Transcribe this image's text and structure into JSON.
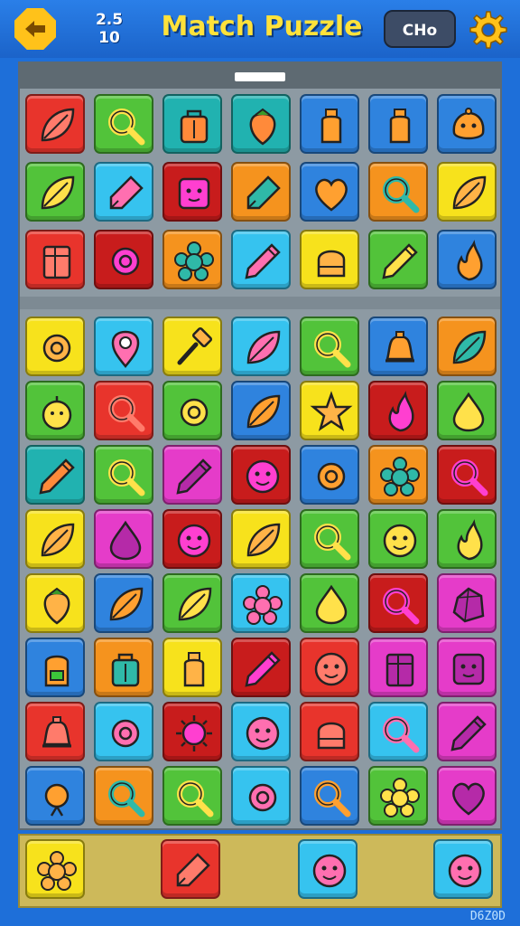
{
  "header": {
    "title": "Match Puzzle",
    "score_line1": "2.5",
    "score_line2": "10",
    "mode_button": "CHo",
    "back_icon": "back-arrow-icon",
    "settings_icon": "gear-icon"
  },
  "colors": {
    "red": "#e8342c",
    "yellow": "#f7e21c",
    "green": "#52c33a",
    "teal": "#21b2b0",
    "blue": "#2f83de",
    "orange": "#f5931e",
    "pink": "#e53cc9",
    "sky": "#36c3ef",
    "darkred": "#c81c1c"
  },
  "grid": [
    [
      {
        "color": "red",
        "icon": "leaf-icon"
      },
      {
        "color": "green",
        "icon": "magnifier-icon"
      },
      {
        "color": "teal",
        "icon": "bag-icon"
      },
      {
        "color": "teal",
        "icon": "strawberry-icon"
      },
      {
        "color": "blue",
        "icon": "bottle-icon"
      },
      {
        "color": "blue",
        "icon": "bottle-icon"
      },
      {
        "color": "blue",
        "icon": "blob-icon"
      }
    ],
    [
      {
        "color": "green",
        "icon": "leaf-icon"
      },
      {
        "color": "sky",
        "icon": "brush-icon"
      },
      {
        "color": "darkred",
        "icon": "cube-face-icon"
      },
      {
        "color": "orange",
        "icon": "brush-icon"
      },
      {
        "color": "blue",
        "icon": "heart-icon"
      },
      {
        "color": "orange",
        "icon": "magnifier-icon"
      },
      {
        "color": "yellow",
        "icon": "leaf-icon"
      }
    ],
    [
      {
        "color": "red",
        "icon": "box-icon"
      },
      {
        "color": "darkred",
        "icon": "ring-icon"
      },
      {
        "color": "orange",
        "icon": "flower-icon"
      },
      {
        "color": "sky",
        "icon": "pencil-icon"
      },
      {
        "color": "yellow",
        "icon": "jelly-icon"
      },
      {
        "color": "green",
        "icon": "pencil-icon"
      },
      {
        "color": "blue",
        "icon": "flame-icon"
      }
    ],
    [
      {
        "color": "yellow",
        "icon": "ring-icon"
      },
      {
        "color": "sky",
        "icon": "pin-icon"
      },
      {
        "color": "yellow",
        "icon": "hammer-icon"
      },
      {
        "color": "sky",
        "icon": "leaf-icon"
      },
      {
        "color": "green",
        "icon": "magnifier-icon"
      },
      {
        "color": "blue",
        "icon": "bell-icon"
      },
      {
        "color": "orange",
        "icon": "leaf-icon"
      }
    ],
    [
      {
        "color": "green",
        "icon": "fruit-icon"
      },
      {
        "color": "red",
        "icon": "magnifier-icon"
      },
      {
        "color": "green",
        "icon": "ring-icon"
      },
      {
        "color": "blue",
        "icon": "leaf-icon"
      },
      {
        "color": "yellow",
        "icon": "star-icon"
      },
      {
        "color": "darkred",
        "icon": "flame-icon"
      },
      {
        "color": "green",
        "icon": "drop-icon"
      }
    ],
    [
      {
        "color": "teal",
        "icon": "pencil-icon"
      },
      {
        "color": "green",
        "icon": "magnifier-icon"
      },
      {
        "color": "pink",
        "icon": "pencil-icon"
      },
      {
        "color": "darkred",
        "icon": "face-icon"
      },
      {
        "color": "blue",
        "icon": "ring-icon"
      },
      {
        "color": "orange",
        "icon": "flower-icon"
      },
      {
        "color": "darkred",
        "icon": "magnifier-icon"
      }
    ],
    [
      {
        "color": "yellow",
        "icon": "leaf-icon"
      },
      {
        "color": "pink",
        "icon": "drop-icon"
      },
      {
        "color": "darkred",
        "icon": "face-icon"
      },
      {
        "color": "yellow",
        "icon": "leaf-icon"
      },
      {
        "color": "green",
        "icon": "magnifier-icon"
      },
      {
        "color": "green",
        "icon": "face-icon"
      },
      {
        "color": "green",
        "icon": "flame-icon"
      }
    ],
    [
      {
        "color": "yellow",
        "icon": "strawberry-icon"
      },
      {
        "color": "blue",
        "icon": "leaf-icon"
      },
      {
        "color": "green",
        "icon": "leaf-icon"
      },
      {
        "color": "sky",
        "icon": "flower-icon"
      },
      {
        "color": "green",
        "icon": "drop-icon"
      },
      {
        "color": "darkred",
        "icon": "magnifier-icon"
      },
      {
        "color": "pink",
        "icon": "gem-icon"
      }
    ],
    [
      {
        "color": "blue",
        "icon": "backpack-icon"
      },
      {
        "color": "orange",
        "icon": "bag-icon"
      },
      {
        "color": "yellow",
        "icon": "bottle-icon"
      },
      {
        "color": "darkred",
        "icon": "pencil-icon"
      },
      {
        "color": "red",
        "icon": "face-icon"
      },
      {
        "color": "pink",
        "icon": "box-icon"
      },
      {
        "color": "pink",
        "icon": "cube-face-icon"
      }
    ],
    [
      {
        "color": "red",
        "icon": "bell-icon"
      },
      {
        "color": "sky",
        "icon": "ring-icon"
      },
      {
        "color": "darkred",
        "icon": "sun-icon"
      },
      {
        "color": "sky",
        "icon": "face-icon"
      },
      {
        "color": "red",
        "icon": "jelly-icon"
      },
      {
        "color": "sky",
        "icon": "magnifier-icon"
      },
      {
        "color": "pink",
        "icon": "pencil-icon"
      }
    ],
    [
      {
        "color": "blue",
        "icon": "candy-icon"
      },
      {
        "color": "orange",
        "icon": "magnifier-icon"
      },
      {
        "color": "green",
        "icon": "magnifier-icon"
      },
      {
        "color": "sky",
        "icon": "ring-icon"
      },
      {
        "color": "blue",
        "icon": "magnifier-icon"
      },
      {
        "color": "green",
        "icon": "flower-icon"
      },
      {
        "color": "pink",
        "icon": "heart-icon"
      }
    ]
  ],
  "tray": [
    {
      "color": "yellow",
      "icon": "flower-icon"
    },
    {
      "color": "red",
      "icon": "brush-icon"
    },
    {
      "color": "sky",
      "icon": "face-icon"
    },
    {
      "color": "sky",
      "icon": "face-icon"
    }
  ],
  "footer_code": "D6Z0D"
}
